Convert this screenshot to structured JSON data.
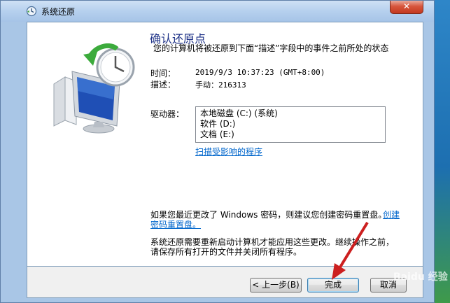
{
  "window": {
    "title": "系统还原",
    "close_glyph": "✕"
  },
  "confirm": {
    "heading": "确认还原点",
    "description": "您的计算机将被还原到下面“描述”字段中的事件之前所处的状态",
    "time_label": "时间：",
    "time_value": "2019/9/3 10:37:23 (GMT+8:00)",
    "desc_label": "描述：",
    "desc_value": "手动：216313",
    "drives_label": "驱动器：",
    "drives": [
      "本地磁盘 (C:) (系统)",
      "软件 (D:)",
      "文档 (E:)"
    ],
    "scan_link": "扫描受影响的程序"
  },
  "notice": {
    "password_text": "如果您最近更改了 Windows 密码，则建议您创建密码重置盘。",
    "password_link_a": "创建",
    "password_link_b": "密码重置盘。",
    "restart_line1": "系统还原需要重新启动计算机才能应用这些更改。继续操作之前，",
    "restart_line2": "请保存所有打开的文件并关闭所有程序。"
  },
  "buttons": {
    "back": "< 上一步(B)",
    "finish": "完成",
    "cancel": "取消"
  },
  "overlay": {
    "watermark": "Baidu 经验",
    "arrow_color": "#cc1f1f"
  }
}
